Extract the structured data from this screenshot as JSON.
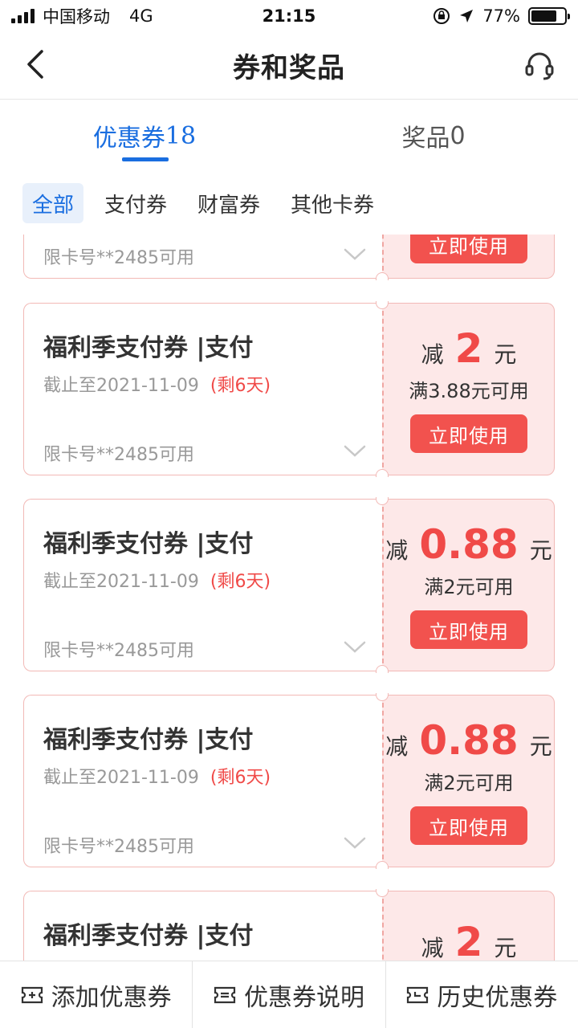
{
  "status_bar": {
    "carrier": "中国移动",
    "network": "4G",
    "time": "21:15",
    "battery": "77%",
    "battery_level": 0.77
  },
  "nav": {
    "title": "券和奖品"
  },
  "tabs": [
    {
      "label": "优惠券",
      "count": "18",
      "active": true
    },
    {
      "label": "奖品",
      "count": "0",
      "active": false
    }
  ],
  "filters": [
    "全部",
    "支付券",
    "财富券",
    "其他卡券"
  ],
  "coupons": [
    {
      "title": "",
      "date": "",
      "remain": "",
      "limit": "限卡号**2485可用",
      "prefix": "",
      "value": "",
      "unit": "",
      "condition": "",
      "button": "立即使用"
    },
    {
      "title": "福利季支付券 |支付",
      "date": "截止至2021-11-09",
      "remain": "(剩6天)",
      "limit": "限卡号**2485可用",
      "prefix": "减",
      "value": "2",
      "unit": "元",
      "condition": "满3.88元可用",
      "button": "立即使用"
    },
    {
      "title": "福利季支付券 |支付",
      "date": "截止至2021-11-09",
      "remain": "(剩6天)",
      "limit": "限卡号**2485可用",
      "prefix": "减",
      "value": "0.88",
      "unit": "元",
      "condition": "满2元可用",
      "button": "立即使用"
    },
    {
      "title": "福利季支付券 |支付",
      "date": "截止至2021-11-09",
      "remain": "(剩6天)",
      "limit": "限卡号**2485可用",
      "prefix": "减",
      "value": "0.88",
      "unit": "元",
      "condition": "满2元可用",
      "button": "立即使用"
    },
    {
      "title": "福利季支付券 |支付",
      "date": "",
      "remain": "",
      "limit": "",
      "prefix": "减",
      "value": "2",
      "unit": "元",
      "condition": "",
      "button": ""
    }
  ],
  "bottom_bar": [
    {
      "label": "添加优惠券",
      "icon": "add-coupon-icon"
    },
    {
      "label": "优惠券说明",
      "icon": "coupon-info-icon"
    },
    {
      "label": "历史优惠券",
      "icon": "coupon-history-icon"
    }
  ],
  "colors": {
    "accent": "#1a6ee0",
    "coupon_red": "#f04a48",
    "coupon_bg": "#fde8e8"
  }
}
